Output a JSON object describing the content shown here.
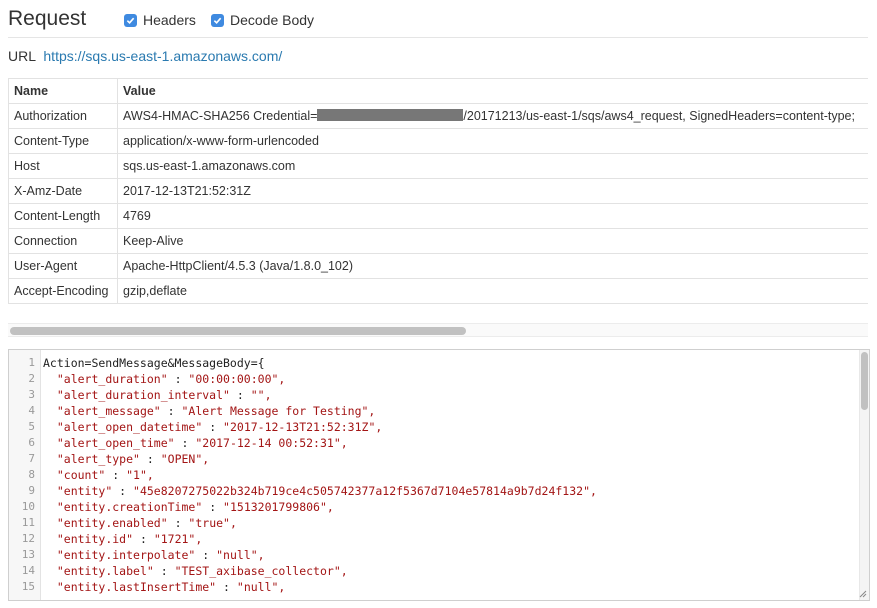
{
  "header": {
    "title": "Request",
    "headers_label": "Headers",
    "headers_checked": true,
    "decode_label": "Decode Body",
    "decode_checked": true
  },
  "url": {
    "label": "URL",
    "value": "https://sqs.us-east-1.amazonaws.com/"
  },
  "table": {
    "columns": [
      "Name",
      "Value"
    ],
    "rows": [
      {
        "name": "Authorization",
        "value_pre": "AWS4-HMAC-SHA256 Credential=",
        "value_post": "/20171213/us-east-1/sqs/aws4_request, SignedHeaders=content-type;"
      },
      {
        "name": "Content-Type",
        "value": "application/x-www-form-urlencoded"
      },
      {
        "name": "Host",
        "value": "sqs.us-east-1.amazonaws.com"
      },
      {
        "name": "X-Amz-Date",
        "value": "2017-12-13T21:52:31Z"
      },
      {
        "name": "Content-Length",
        "value": "4769"
      },
      {
        "name": "Connection",
        "value": "Keep-Alive"
      },
      {
        "name": "User-Agent",
        "value": "Apache-HttpClient/4.5.3 (Java/1.8.0_102)"
      },
      {
        "name": "Accept-Encoding",
        "value": "gzip,deflate"
      }
    ]
  },
  "body": {
    "lines": [
      {
        "n": "1",
        "first": "Action=SendMessage&MessageBody={"
      },
      {
        "n": "2",
        "key": "\"alert_duration\"",
        "val": "\"00:00:00:00\","
      },
      {
        "n": "3",
        "key": "\"alert_duration_interval\"",
        "val": "\"\","
      },
      {
        "n": "4",
        "key": "\"alert_message\"",
        "val": "\"Alert Message for Testing\","
      },
      {
        "n": "5",
        "key": "\"alert_open_datetime\"",
        "val": "\"2017-12-13T21:52:31Z\","
      },
      {
        "n": "6",
        "key": "\"alert_open_time\"",
        "val": "\"2017-12-14 00:52:31\","
      },
      {
        "n": "7",
        "key": "\"alert_type\"",
        "val": "\"OPEN\","
      },
      {
        "n": "8",
        "key": "\"count\"",
        "val": "\"1\","
      },
      {
        "n": "9",
        "key": "\"entity\"",
        "val": "\"45e8207275022b324b719ce4c505742377a12f5367d7104e57814a9b7d24f132\","
      },
      {
        "n": "10",
        "key": "\"entity.creationTime\"",
        "val": "\"1513201799806\","
      },
      {
        "n": "11",
        "key": "\"entity.enabled\"",
        "val": "\"true\","
      },
      {
        "n": "12",
        "key": "\"entity.id\"",
        "val": "\"1721\","
      },
      {
        "n": "13",
        "key": "\"entity.interpolate\"",
        "val": "\"null\","
      },
      {
        "n": "14",
        "key": "\"entity.label\"",
        "val": "\"TEST_axibase_collector\","
      },
      {
        "n": "15",
        "key": "\"entity.lastInsertTime\"",
        "val": "\"null\","
      }
    ]
  },
  "colors": {
    "accent": "#3f8ae0",
    "link": "#2a7ab0",
    "string": "#a31515"
  }
}
